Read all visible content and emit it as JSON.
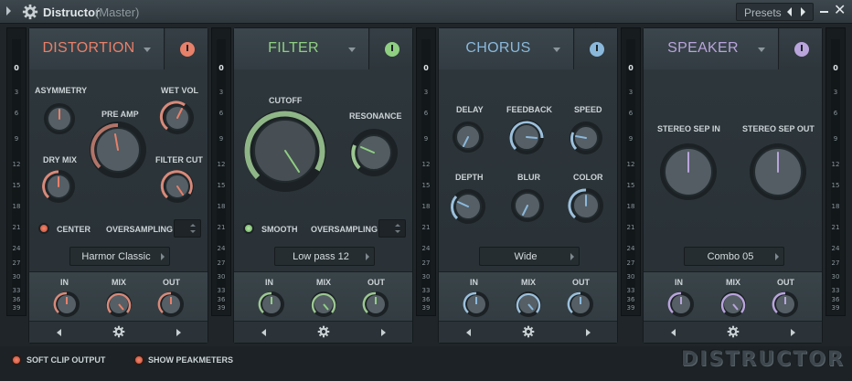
{
  "window": {
    "title": "Distructor",
    "subtitle": "(Master)",
    "presets_label": "Presets"
  },
  "meter_ticks": [
    "0",
    "3",
    "6",
    "9",
    "12",
    "15",
    "18",
    "21",
    "24",
    "27",
    "30",
    "33",
    "36",
    "39"
  ],
  "colors": {
    "distortion": "#e8806a",
    "filter": "#8fcf82",
    "chorus": "#8ab8dc",
    "speaker": "#b9a4dc"
  },
  "modules": [
    {
      "title": "DISTORTION",
      "accent": "#e8806a",
      "knob_labels": [
        "ASYMMETRY",
        "PRE AMP",
        "WET VOL",
        "DRY MIX",
        "FILTER CUT"
      ],
      "toggle_label": "CENTER",
      "oversampling_label": "OVERSAMPLING",
      "selector": "Harmor Classic",
      "io": [
        "IN",
        "MIX",
        "OUT"
      ]
    },
    {
      "title": "FILTER",
      "accent": "#8fcf82",
      "knob_labels": [
        "CUTOFF",
        "RESONANCE"
      ],
      "toggle_label": "SMOOTH",
      "oversampling_label": "OVERSAMPLING",
      "selector": "Low pass 12",
      "io": [
        "IN",
        "MIX",
        "OUT"
      ]
    },
    {
      "title": "CHORUS",
      "accent": "#8ab8dc",
      "knob_labels": [
        "DELAY",
        "FEEDBACK",
        "SPEED",
        "DEPTH",
        "BLUR",
        "COLOR"
      ],
      "selector": "Wide",
      "io": [
        "IN",
        "MIX",
        "OUT"
      ]
    },
    {
      "title": "SPEAKER",
      "accent": "#b9a4dc",
      "knob_labels": [
        "STEREO SEP IN",
        "STEREO SEP OUT"
      ],
      "selector": "Combo 05",
      "io": [
        "IN",
        "MIX",
        "OUT"
      ]
    }
  ],
  "bottom": {
    "soft_clip_label": "SOFT CLIP OUTPUT",
    "peakmeters_label": "SHOW PEAKMETERS",
    "logo": "DISTRUCTOR"
  },
  "icons": {
    "settings": "gear-icon",
    "expand": "triangle-right-icon",
    "prev": "arrow-left-icon",
    "next": "arrow-right-icon",
    "minimize": "minimize-icon",
    "close": "close-icon",
    "power": "power-icon"
  }
}
